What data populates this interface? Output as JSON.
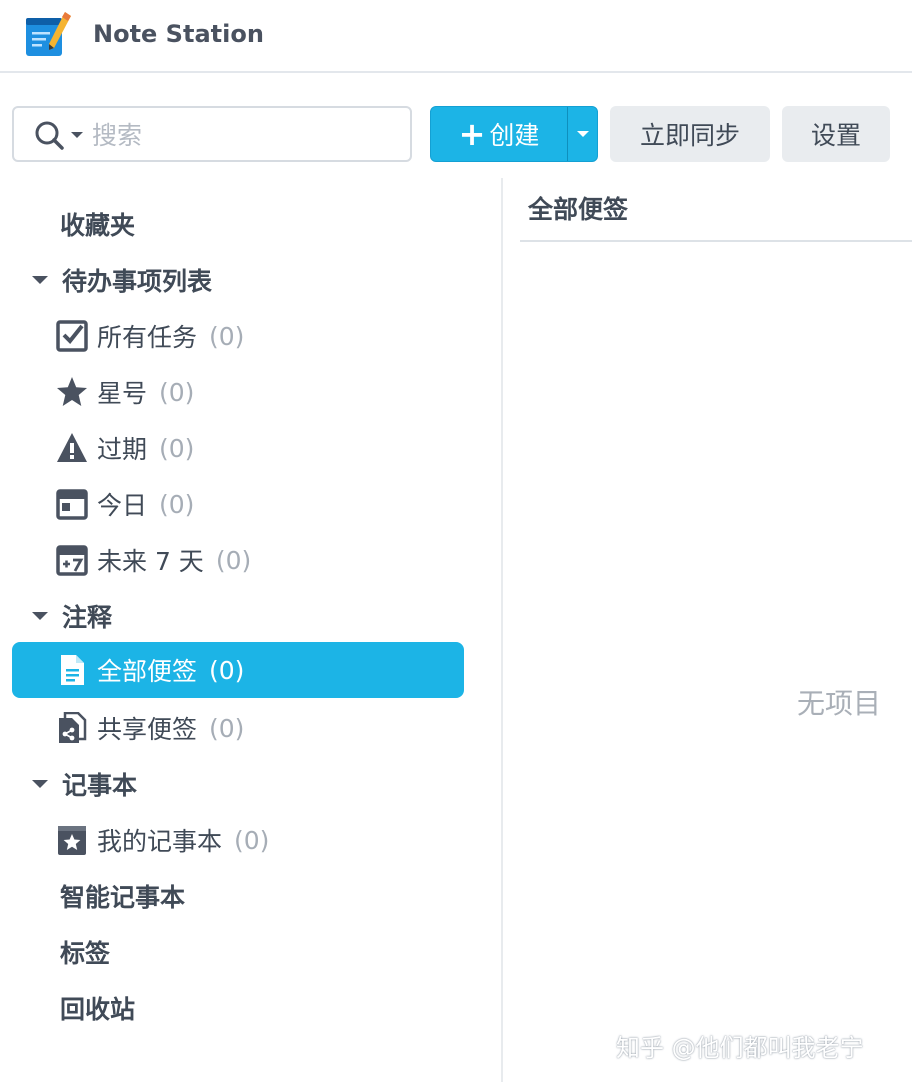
{
  "app": {
    "title": "Note Station",
    "icon": "note-station-logo-icon"
  },
  "toolbar": {
    "search": {
      "placeholder": "搜索",
      "value": ""
    },
    "create_label": "创建",
    "sync_label": "立即同步",
    "settings_label": "设置"
  },
  "sidebar": {
    "favorites": "收藏夹",
    "todo": {
      "label": "待办事项列表",
      "items": [
        {
          "label": "所有任务",
          "count": "(0)",
          "icon": "checkbox-icon"
        },
        {
          "label": "星号",
          "count": "(0)",
          "icon": "star-icon"
        },
        {
          "label": "过期",
          "count": "(0)",
          "icon": "warning-icon"
        },
        {
          "label": "今日",
          "count": "(0)",
          "icon": "calendar-icon"
        },
        {
          "label": "未来 7 天",
          "count": "(0)",
          "icon": "calendar-plus7-icon"
        }
      ]
    },
    "notes": {
      "label": "注释",
      "items": [
        {
          "label": "全部便签",
          "count": "(0)",
          "icon": "note-icon",
          "active": true
        },
        {
          "label": "共享便签",
          "count": "(0)",
          "icon": "shared-note-icon"
        }
      ]
    },
    "notebooks": {
      "label": "记事本",
      "items": [
        {
          "label": "我的记事本",
          "count": "(0)",
          "icon": "starred-notebook-icon"
        }
      ]
    },
    "smart_notebooks": "智能记事本",
    "tags": "标签",
    "trash": "回收站"
  },
  "main": {
    "list_title": "全部便签",
    "empty_text": "无项目"
  },
  "watermark": "知乎 @他们都叫我老宁",
  "colors": {
    "accent": "#1cb4e6",
    "text": "#404a57",
    "muted": "#a6adb6"
  }
}
